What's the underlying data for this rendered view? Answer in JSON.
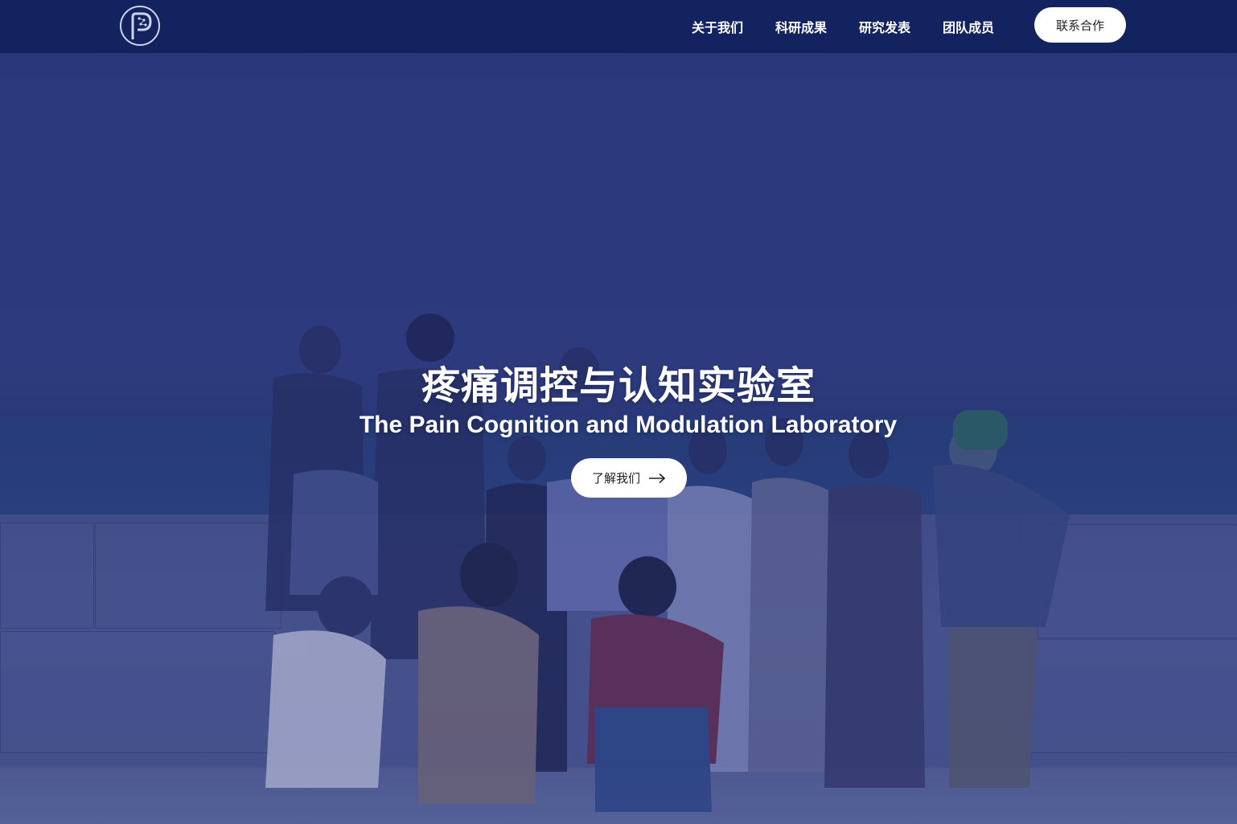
{
  "header": {
    "logo_icon": "lab-logo-icon",
    "nav": [
      {
        "label": "关于我们"
      },
      {
        "label": "科研成果"
      },
      {
        "label": "研究发表"
      },
      {
        "label": "团队成员"
      }
    ],
    "contact_label": "联系合作"
  },
  "hero": {
    "title": "疼痛调控与认知实验室",
    "subtitle": "The Pain Cognition and Modulation Laboratory",
    "cta_label": "了解我们",
    "cta_icon": "arrow-right-icon",
    "background_icon": "group-photo-at-seaside",
    "overlay_color": "#2c3a80"
  },
  "colors": {
    "header_bg": "#13235f",
    "button_bg": "#ffffff",
    "text_light": "#ffffff"
  }
}
